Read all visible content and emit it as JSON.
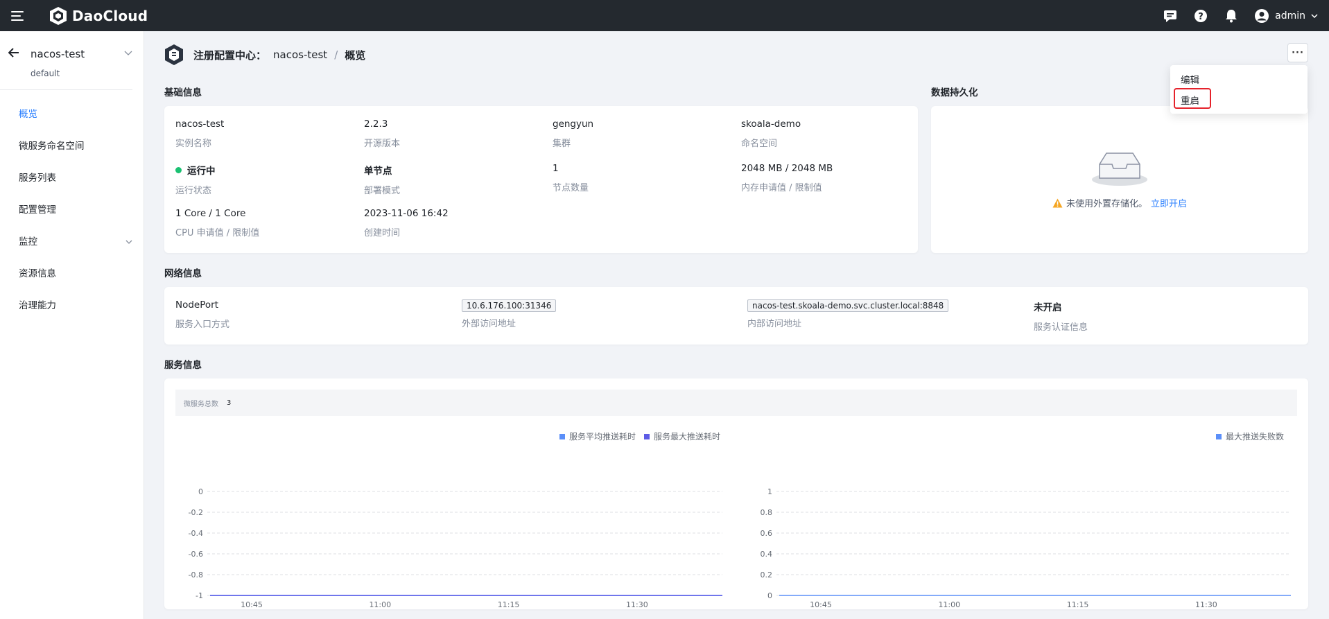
{
  "topbar": {
    "logo": "DaoCloud",
    "user": "admin",
    "icons": [
      "menu-icon",
      "message-icon",
      "help-icon",
      "bell-icon",
      "user-icon",
      "chevron-down-icon"
    ]
  },
  "sidebar": {
    "workspace_name": "nacos-test",
    "workspace_sub": "default",
    "items": [
      {
        "label": "概览",
        "active": true
      },
      {
        "label": "微服务命名空间"
      },
      {
        "label": "服务列表"
      },
      {
        "label": "配置管理"
      },
      {
        "label": "监控",
        "expandable": true
      },
      {
        "label": "资源信息"
      },
      {
        "label": "治理能力"
      }
    ]
  },
  "header": {
    "crumb_root": "注册配置中心：",
    "crumb_instance": "nacos-test",
    "crumb_sep": "/",
    "crumb_current": "概览",
    "more_label": "···"
  },
  "dropdown": {
    "items": [
      "编辑",
      "重启"
    ],
    "highlight_color": "#e5222b"
  },
  "basic": {
    "title": "基础信息",
    "fields": [
      {
        "value": "nacos-test",
        "label": "实例名称"
      },
      {
        "value": "2.2.3",
        "label": "开源版本"
      },
      {
        "value": "gengyun",
        "label": "集群"
      },
      {
        "value": "skoala-demo",
        "label": "命名空间"
      },
      {
        "value": "运行中",
        "label": "运行状态",
        "status_color": "#1ac172"
      },
      {
        "value": "单节点",
        "label": "部署模式"
      },
      {
        "value": "1",
        "label": "节点数量"
      },
      {
        "value": "2048 MB / 2048 MB",
        "label": "内存申请值 / 限制值"
      },
      {
        "value": "1 Core / 1 Core",
        "label": "CPU 申请值 / 限制值"
      },
      {
        "value": "2023-11-06 16:42",
        "label": "创建时间"
      }
    ]
  },
  "persist": {
    "title": "数据持久化",
    "message": "未使用外置存储化。",
    "link": "立即开启"
  },
  "network": {
    "title": "网络信息",
    "fields": [
      {
        "value": "NodePort",
        "label": "服务入口方式"
      },
      {
        "value": "10.6.176.100:31346",
        "label": "外部访问地址"
      },
      {
        "value": "nacos-test.skoala-demo.svc.cluster.local:8848",
        "label": "内部访问地址"
      },
      {
        "value": "未开启",
        "label": "服务认证信息"
      }
    ]
  },
  "service": {
    "title": "服务信息",
    "stat_label": "微服务总数",
    "stat_value": "3"
  },
  "chart_data": [
    {
      "type": "line",
      "title": "",
      "x": [
        "10:45",
        "11:00",
        "11:15",
        "11:30"
      ],
      "ylim": [
        -1,
        0
      ],
      "yticks": [
        "0",
        "-0.2",
        "-0.4",
        "-0.6",
        "-0.8",
        "-1"
      ],
      "grid": true,
      "legend": "top-right",
      "series": [
        {
          "name": "服务平均推送耗时",
          "color": "#5b8ff9",
          "values": [
            -1,
            -1,
            -1,
            -1
          ]
        },
        {
          "name": "服务最大推送耗时",
          "color": "#5d5ce6",
          "values": [
            -1,
            -1,
            -1,
            -1
          ]
        }
      ]
    },
    {
      "type": "line",
      "title": "",
      "x": [
        "10:45",
        "11:00",
        "11:15",
        "11:30"
      ],
      "ylim": [
        0,
        1
      ],
      "yticks": [
        "1",
        "0.8",
        "0.6",
        "0.4",
        "0.2",
        "0"
      ],
      "grid": true,
      "legend": "top-right",
      "series": [
        {
          "name": "最大推送失败数",
          "color": "#5b8ff9",
          "values": [
            0,
            0,
            0,
            0
          ]
        }
      ]
    }
  ]
}
